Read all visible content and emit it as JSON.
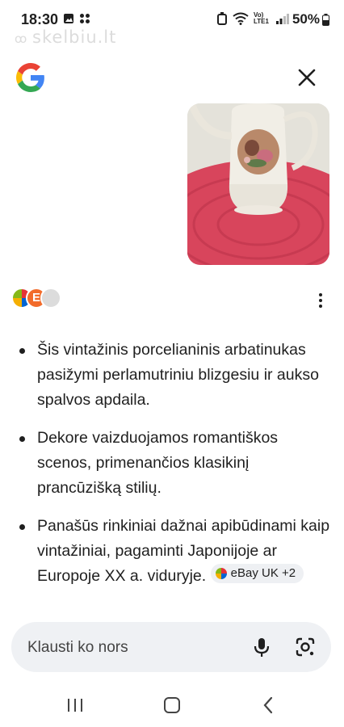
{
  "status_bar": {
    "time": "18:30",
    "network_label": "Vo) LTE1",
    "battery": "50%"
  },
  "watermark": "skelbiu.lt",
  "header": {
    "logo_icon": "google-g-icon",
    "close_icon": "close-icon"
  },
  "sources": {
    "icons": [
      "ebay-source-icon",
      "e-source-icon",
      "globe-source-icon"
    ],
    "more_icon": "more-vert-icon"
  },
  "bullets": [
    {
      "text": "Šis vintažinis porcelianinis arbatinukas pasižymi perlamutriniu blizgesiu ir aukso spalvos apdaila."
    },
    {
      "text": "Dekore vaizduojamos romantiškos scenos, primenančios klasikinį prancūzišką stilių."
    },
    {
      "text": "Panašūs rinkiniai dažnai apibūdinami kaip vintažiniai, pagaminti Japonijoje ar Europoje XX a. viduryje.",
      "chip": "eBay UK +2"
    }
  ],
  "search": {
    "placeholder": "Klausti ko nors",
    "mic_icon": "mic-icon",
    "lens_icon": "google-lens-icon"
  },
  "nav": {
    "recents_icon": "recents-icon",
    "home_icon": "home-icon",
    "back_icon": "back-icon"
  },
  "colors": {
    "background": "#ffffff",
    "search_bg": "#eff1f4",
    "chip_bg": "#eef0f3",
    "text": "#1f1f1f",
    "placemat": "#d8455c"
  }
}
